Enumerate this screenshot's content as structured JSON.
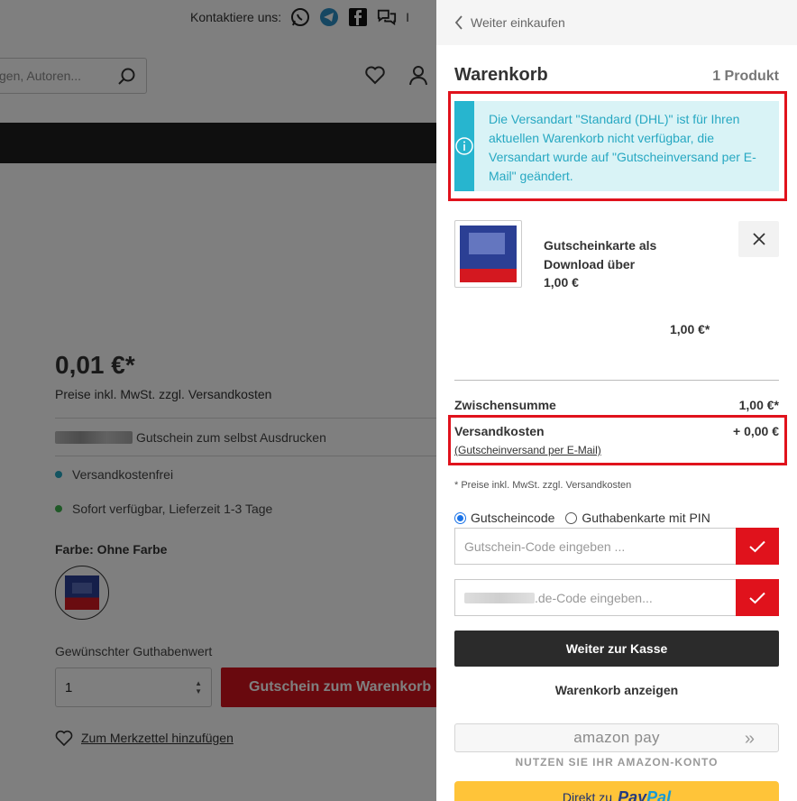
{
  "page": {
    "contact_label": "Kontaktiere uns:",
    "contact_separator": "I",
    "search_placeholder": "gen, Autoren...",
    "price": "0,01 €*",
    "price_note": "Preise inkl. MwSt. zzgl. Versandkosten",
    "seller_text": "Gutschein zum selbst Ausdrucken",
    "features": [
      "Versandkostenfrei",
      "Sofort verfügbar, Lieferzeit 1-3 Tage"
    ],
    "feature_colors": [
      "#27a8c2",
      "#3fb34f"
    ],
    "color_label": "Farbe: Ohne Farbe",
    "value_label": "Gewünschter Guthabenwert",
    "quantity": "1",
    "add_to_cart": "Gutschein zum Warenkorb",
    "wishlist": "Zum Merkzettel hinzufügen"
  },
  "cart": {
    "back_label": "Weiter einkaufen",
    "title": "Warenkorb",
    "count": "1 Produkt",
    "alert": "Die Versandart \"Standard (DHL)\" ist für Ihren aktuellen Warenkorb nicht verfügbar, die Versandart wurde auf \"Gutscheinversand per E-Mail\" geändert.",
    "item": {
      "name": "Gutscheinkarte als Download über",
      "unit_price": "1,00 €",
      "total": "1,00 €*"
    },
    "subtotal_label": "Zwischensumme",
    "subtotal_value": "1,00 €*",
    "shipping_label": "Versandkosten",
    "shipping_value": "+ 0,00 €",
    "shipping_method": "(Gutscheinversand per E-Mail)",
    "price_footnote": "* Preise inkl. MwSt. zzgl. Versandkosten",
    "radio_voucher": "Gutscheincode",
    "radio_giftcard": "Guthabenkarte mit PIN",
    "voucher_placeholder": "Gutschein-Code eingeben ...",
    "partner_code_placeholder": ".de-Code eingeben...",
    "checkout_label": "Weiter zur Kasse",
    "show_cart_label": "Warenkorb anzeigen",
    "amazon_label": "amazon pay",
    "amazon_hint": "NUTZEN SIE IHR AMAZON-KONTO",
    "paypal_prefix": "Direkt zu",
    "paypal_logo_1": "Pay",
    "paypal_logo_2": "Pal"
  },
  "colors": {
    "brand_red": "#e0121c",
    "info_blue": "#27b5cf",
    "info_bg": "#d9f3f6",
    "dark_button": "#2b2b2b",
    "paypal_yellow": "#ffc439"
  }
}
